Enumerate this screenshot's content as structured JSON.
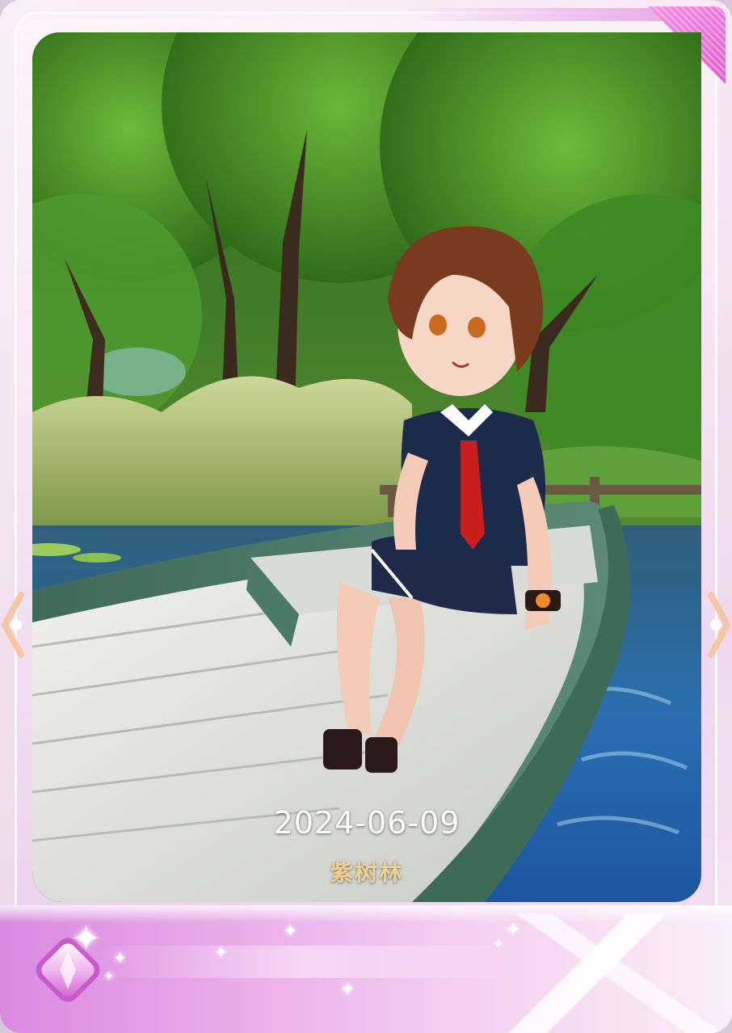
{
  "photo_card": {
    "date": "2024-06-09",
    "location": "紫树林"
  },
  "decorations": {
    "badge_icon": "gem-icon",
    "corner_icon": "corner-pattern-tag",
    "sparkle_icon": "sparkle-icon",
    "left_arrow_icon": "chevron-left-icon",
    "right_arrow_icon": "chevron-right-icon"
  },
  "colors": {
    "accent_pink": "#e35fd0",
    "caption_gold": "#f1cf91",
    "frame_light": "#fbeef6"
  }
}
